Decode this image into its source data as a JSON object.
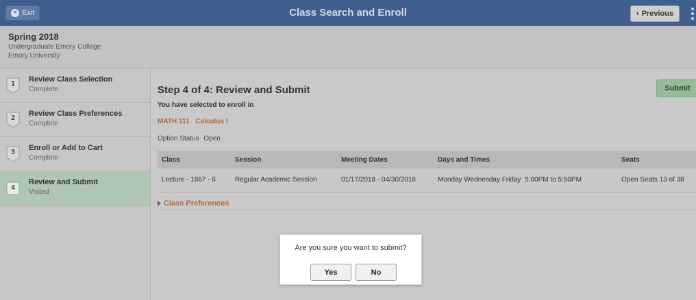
{
  "header": {
    "exit_label": "Exit",
    "title": "Class Search and Enroll",
    "previous_label": "Previous",
    "colors": {
      "bar": "#3f5f8e"
    }
  },
  "term": {
    "title": "Spring 2018",
    "career": "Undergraduate Emory College",
    "institution": "Emory University"
  },
  "steps": [
    {
      "number": "1",
      "label": "Review Class Selection",
      "status": "Complete",
      "active": false
    },
    {
      "number": "2",
      "label": "Review Class Preferences",
      "status": "Complete",
      "active": false
    },
    {
      "number": "3",
      "label": "Enroll or Add to Cart",
      "status": "Complete",
      "active": false
    },
    {
      "number": "4",
      "label": "Review and Submit",
      "status": "Visited",
      "active": true
    }
  ],
  "main": {
    "heading": "Step 4 of 4: Review and Submit",
    "submit_label": "Submit",
    "enroll_text": "You have selected to enroll in",
    "course_code": "MATH 111",
    "course_name": "Calculus I",
    "option_status_label": "Option Status",
    "option_status_value": "Open",
    "table": {
      "headers": [
        "Class",
        "Session",
        "Meeting Dates",
        "Days and Times",
        "Seats"
      ],
      "rows": [
        [
          "Lecture - 1867 - 6",
          "Regular Academic Session",
          "01/17/2018 - 04/30/2018",
          "Monday Wednesday Friday  5:00PM to 5:50PM",
          "Open Seats 13 of 38"
        ]
      ]
    },
    "preferences_label": "Class Preferences"
  },
  "modal": {
    "message": "Are you sure you want to submit?",
    "yes_label": "Yes",
    "no_label": "No"
  }
}
